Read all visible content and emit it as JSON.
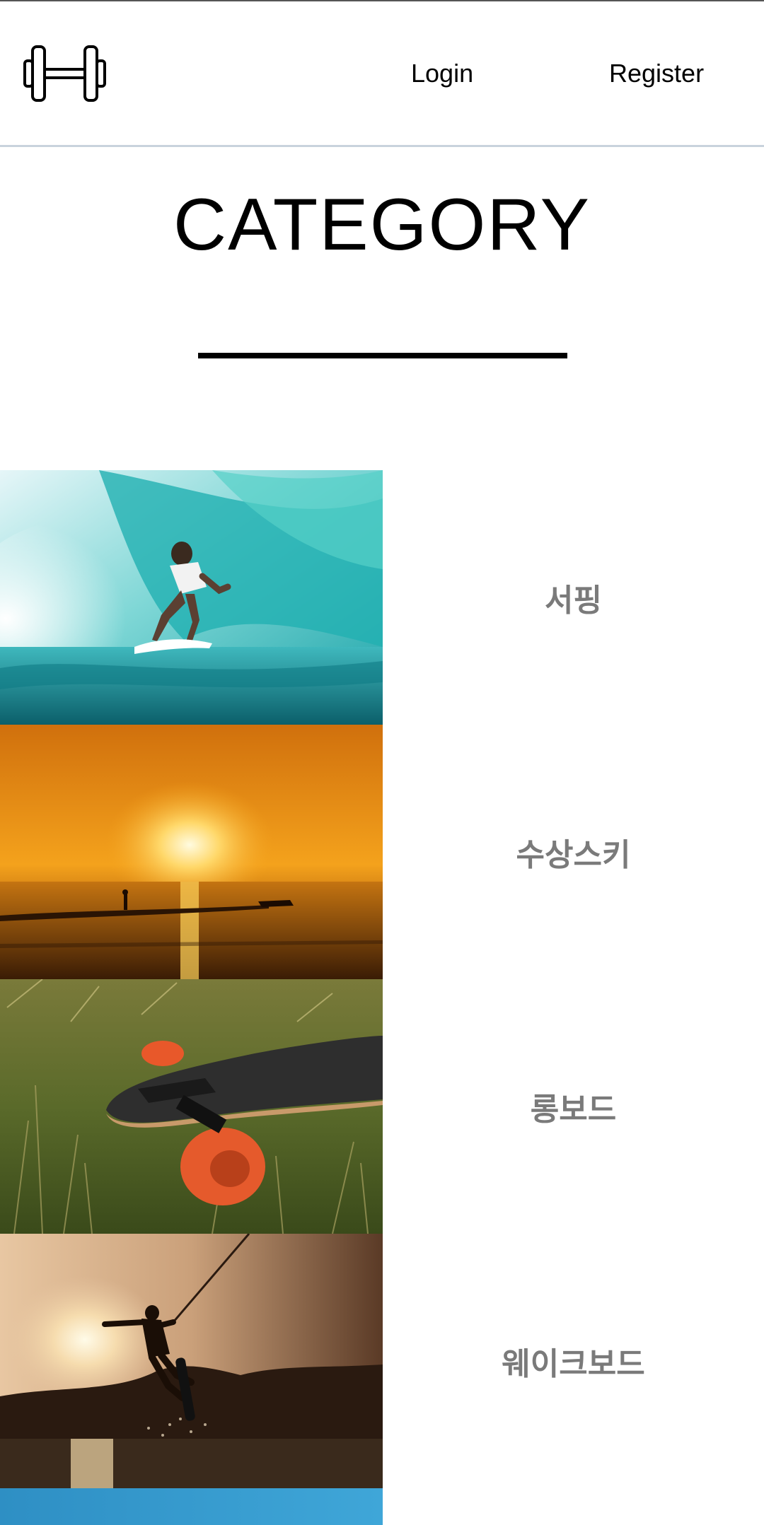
{
  "header": {
    "logo_icon": "dumbbell-icon",
    "login_label": "Login",
    "register_label": "Register"
  },
  "page": {
    "title": "CATEGORY"
  },
  "categories": [
    {
      "label": "서핑",
      "image": "surfer-in-wave-photo"
    },
    {
      "label": "수상스키",
      "image": "water-ski-sunset-photo"
    },
    {
      "label": "롱보드",
      "image": "longboard-on-grass-photo"
    },
    {
      "label": "웨이크보드",
      "image": "wakeboard-jump-sunset-photo"
    },
    {
      "label": "",
      "image": "blue-water-photo-partial"
    }
  ],
  "colors": {
    "label_gray": "#7a7a7a",
    "header_border": "#c9d3dd"
  }
}
